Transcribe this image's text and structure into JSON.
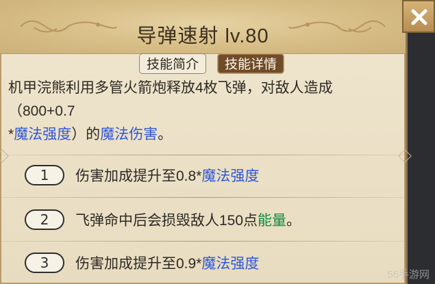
{
  "header": {
    "title": "导弹速射 lv.80"
  },
  "tabs": [
    {
      "label": "技能简介"
    },
    {
      "label": "技能详情"
    }
  ],
  "description": {
    "line1": "机甲浣熊利用多管火箭炮释放4枚飞弹，对敌人造成（800+0.7",
    "line2_prefix": "*",
    "line2_highlight1": "魔法强度",
    "line2_mid": "）的",
    "line2_highlight2": "魔法伤害",
    "line2_suffix": "。"
  },
  "upgrades": [
    {
      "num": "1",
      "text_prefix": "伤害加成提升至0.8*",
      "highlight": "魔法强度",
      "suffix": ""
    },
    {
      "num": "2",
      "text_prefix": "飞弹命中后会损毁敌人150点",
      "highlight": "能量",
      "suffix": "。"
    },
    {
      "num": "3",
      "text_prefix": "伤害加成提升至0.9*",
      "highlight": "魔法强度",
      "suffix": ""
    }
  ],
  "icons": {
    "close": "close-icon",
    "ornament_left": "ornament-left-icon",
    "ornament_right": "ornament-right-icon"
  },
  "watermark": "56手游网",
  "colors": {
    "highlight_blue": "#2f57d9",
    "highlight_green": "#0e8b40",
    "active_tab": "#6f4c2a"
  }
}
